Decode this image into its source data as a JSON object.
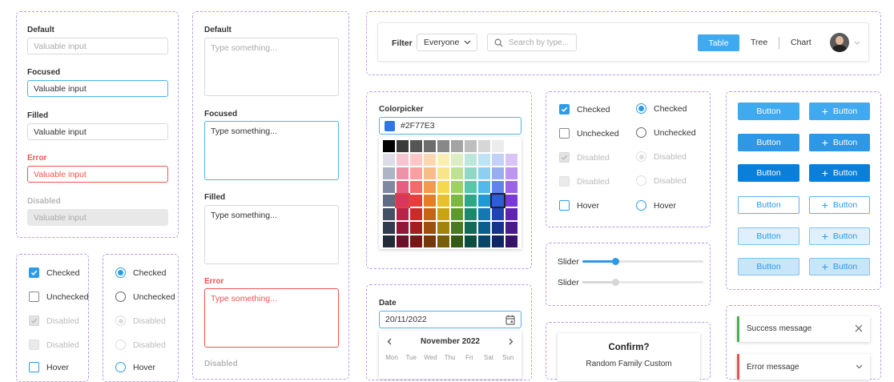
{
  "inputs": {
    "default_label": "Default",
    "default_placeholder": "Valuable input",
    "focused_label": "Focused",
    "focused_value": "Valuable input",
    "filled_label": "Filled",
    "filled_value": "Valuable input",
    "error_label": "Error",
    "error_value": "Valuable input",
    "disabled_label": "Disabled",
    "disabled_value": "Valuable input"
  },
  "textareas": {
    "default_label": "Default",
    "default_placeholder": "Type something...",
    "focused_label": "Focused",
    "focused_value": "Type something...",
    "filled_label": "Filled",
    "filled_value": "Type something...",
    "error_label": "Error",
    "error_value": "Type something...",
    "disabled_label": "Disabled"
  },
  "checkboxes": {
    "checked": "Checked",
    "unchecked": "Unchecked",
    "disabled1": "Disabled",
    "disabled2": "Disabled",
    "hover": "Hover"
  },
  "radios": {
    "checked": "Checked",
    "unchecked": "Unchecked",
    "disabled1": "Disabled",
    "disabled2": "Disabled",
    "hover": "Hover"
  },
  "toolbar": {
    "filter_label": "Filter",
    "filter_value": "Everyone",
    "search_placeholder": "Search by type...",
    "view_table": "Table",
    "view_tree": "Tree",
    "view_chart": "Chart"
  },
  "colorpicker": {
    "label": "Colorpicker",
    "value": "#2F77E3",
    "selected_color": "#2f77e3"
  },
  "date": {
    "label": "Date",
    "value": "20/11/2022",
    "month": "November 2022",
    "weekdays": [
      "Mon",
      "Tue",
      "Wed",
      "Thu",
      "Fri",
      "Sat",
      "Sun"
    ]
  },
  "buttons": {
    "label": "Button",
    "icon_label": "Button"
  },
  "sliders": {
    "slider1_label": "Slider",
    "slider1_value": 0.27,
    "slider2_label": "Slider",
    "slider2_value": 0.27
  },
  "confirm": {
    "title": "Confirm?",
    "body": "Random Family Custom"
  },
  "toasts": {
    "success": "Success message",
    "error": "Error message"
  },
  "colors": {
    "accent": "#2e98e6",
    "panel_border": "#b79af0",
    "error": "#ef5350",
    "success": "#4caf50"
  }
}
